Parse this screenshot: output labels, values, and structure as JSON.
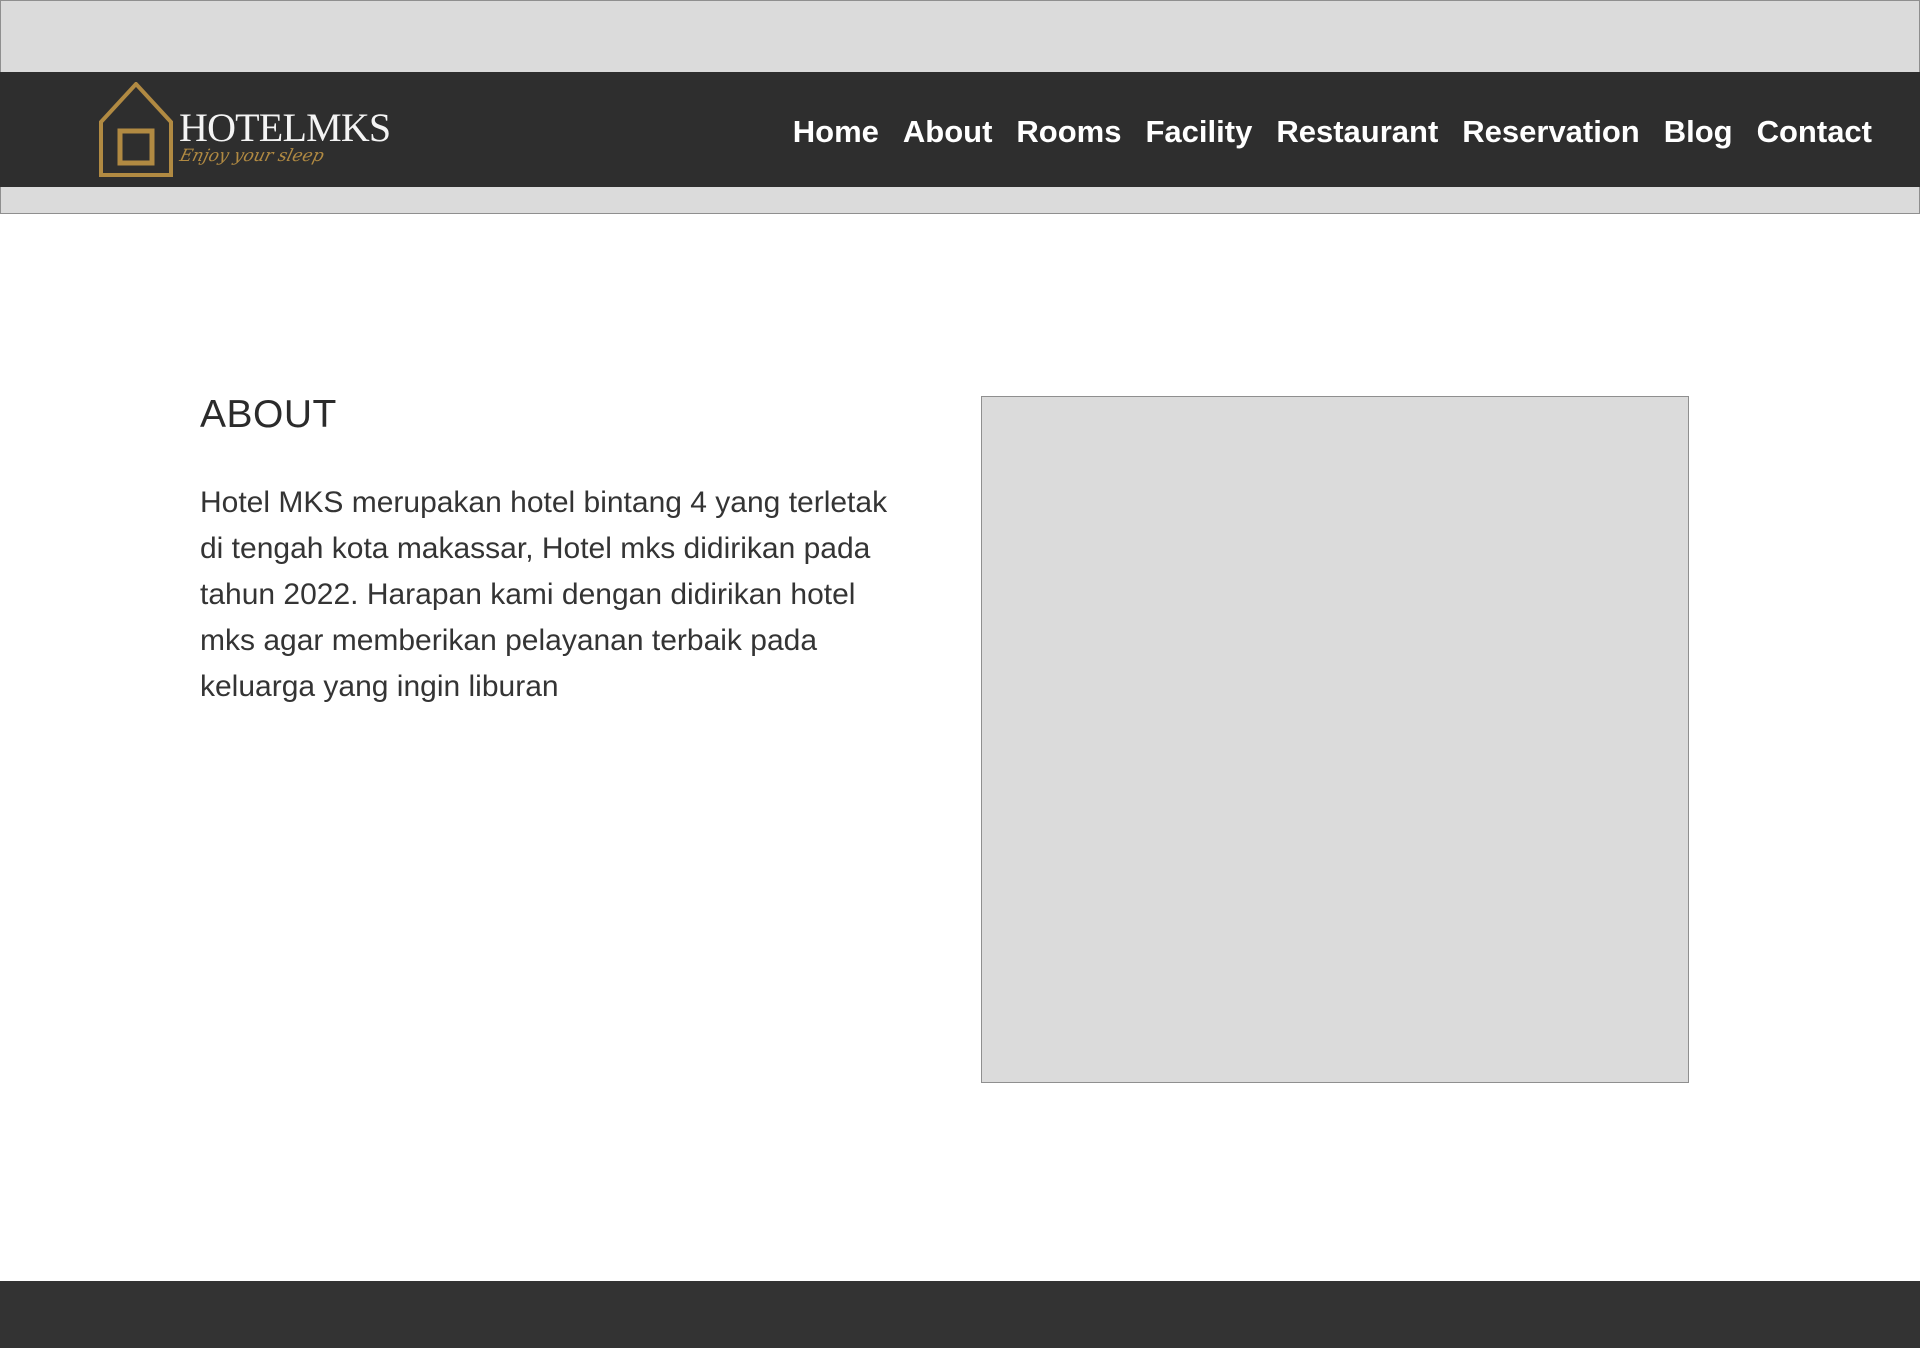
{
  "brand": {
    "name": "HOTELMKS",
    "tagline": "Enjoy your sleep",
    "logo_icon": "house-icon"
  },
  "navigation": {
    "items": [
      {
        "label": "Home"
      },
      {
        "label": "About"
      },
      {
        "label": "Rooms"
      },
      {
        "label": "Facility"
      },
      {
        "label": "Restaurant"
      },
      {
        "label": "Reservation"
      },
      {
        "label": "Blog"
      },
      {
        "label": "Contact"
      }
    ]
  },
  "about": {
    "title": "ABOUT",
    "description": "Hotel MKS merupakan hotel bintang 4 yang terletak di tengah kota makassar, Hotel mks didirikan pada tahun 2022. Harapan kami dengan didirikan hotel mks agar memberikan pelayanan terbaik pada keluarga yang ingin liburan"
  },
  "colors": {
    "header_background": "#2e2e2e",
    "brand_accent": "#b18a42",
    "page_background": "#ffffff",
    "placeholder_background": "#dbdbdb",
    "footer_background": "#333333"
  }
}
